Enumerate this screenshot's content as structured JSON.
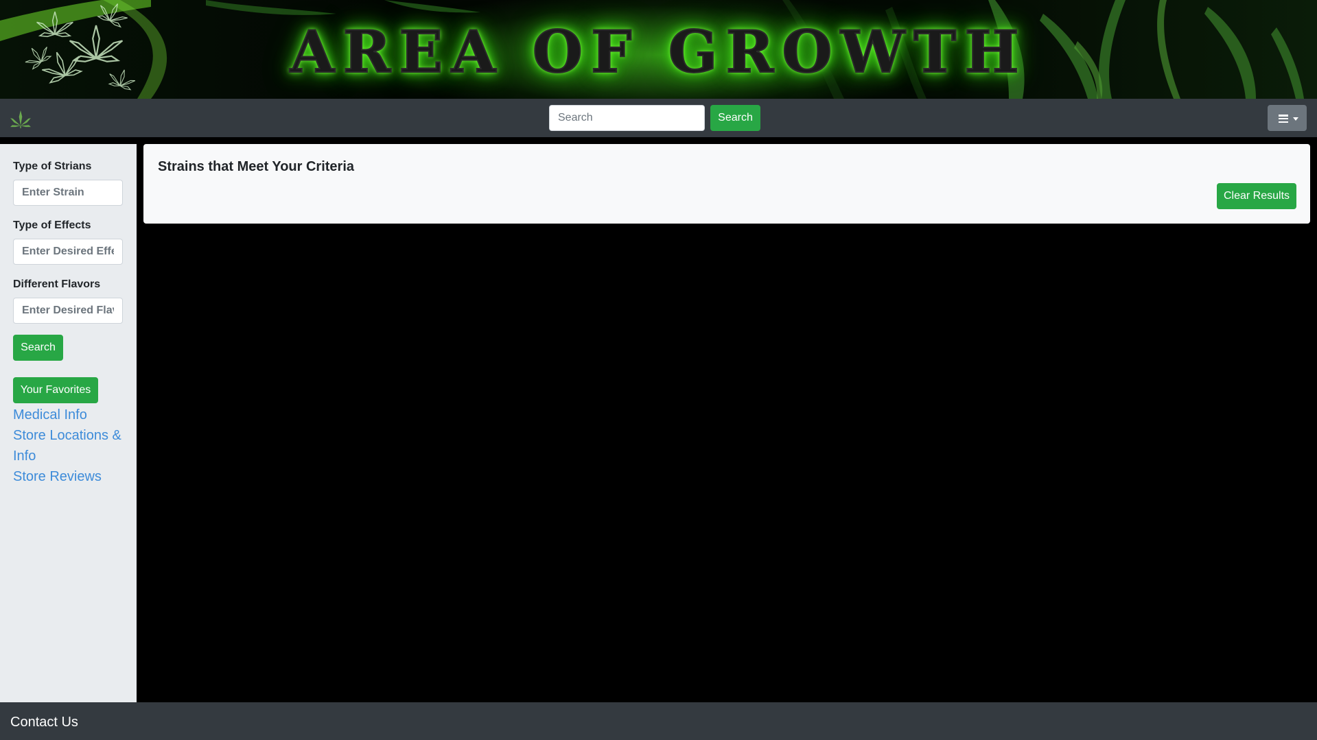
{
  "banner": {
    "title": "AREA OF GROWTH"
  },
  "navbar": {
    "logo_icon": "cannabis-leaf-icon",
    "search_placeholder": "Search",
    "search_button": "Search",
    "menu_icon": "hamburger-menu-icon"
  },
  "sidebar": {
    "strain": {
      "label": "Type of Strians",
      "placeholder": "Enter Strain"
    },
    "effects": {
      "label": "Type of Effects",
      "placeholder": "Enter Desired Effects"
    },
    "flavors": {
      "label": "Different Flavors",
      "placeholder": "Enter Desired Flavors"
    },
    "search_button": "Search",
    "favorites_button": "Your Favorites",
    "links": [
      "Medical Info",
      "Store Locations & Info",
      "Store Reviews"
    ]
  },
  "results": {
    "title": "Strains that Meet Your Criteria",
    "clear_button": "Clear Results"
  },
  "footer": {
    "contact": "Contact Us"
  },
  "colors": {
    "accent_green": "#28a745",
    "navbar_bg": "#343a40",
    "sidebar_bg": "#e9ecef",
    "link_blue": "#3d8bd9"
  }
}
